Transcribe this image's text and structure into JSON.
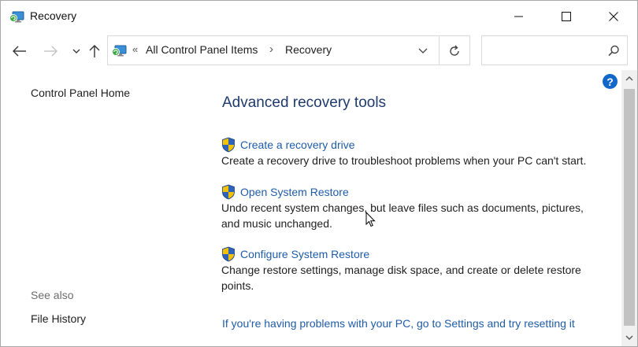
{
  "window": {
    "title": "Recovery",
    "icon": "recovery-control-panel-icon"
  },
  "navigation": {
    "back_icon": "back-arrow-icon",
    "forward_icon": "forward-arrow-icon",
    "recent_icon": "chevron-down-icon",
    "up_icon": "up-arrow-icon"
  },
  "address_bar": {
    "overflow_chevrons": "«",
    "breadcrumbs": [
      "All Control Panel Items",
      "Recovery"
    ],
    "separator": "›"
  },
  "search": {
    "value": "",
    "placeholder": ""
  },
  "left_pane": {
    "home_link": "Control Panel Home",
    "see_also_label": "See also",
    "see_also_links": [
      "File History"
    ]
  },
  "main": {
    "heading": "Advanced recovery tools",
    "tools": [
      {
        "link": "Create a recovery drive",
        "description": [
          "Create a recovery drive to troubleshoot problems when your PC can't start."
        ]
      },
      {
        "link": "Open System Restore",
        "description": [
          "Undo recent system changes, but leave files such as documents, pictures,",
          "and music unchanged."
        ]
      },
      {
        "link": "Configure System Restore",
        "description": [
          "Change restore settings, manage disk space, and create or delete restore",
          "points."
        ]
      }
    ],
    "reset_link": "If you're having problems with your PC, go to Settings and try resetting it"
  },
  "help": {
    "label": "?"
  },
  "colors": {
    "link": "#1f5ca8",
    "heading": "#1e3a6e",
    "help_button": "#1267c8",
    "shield_blue": "#2f63b8",
    "shield_yellow": "#f2c200"
  }
}
